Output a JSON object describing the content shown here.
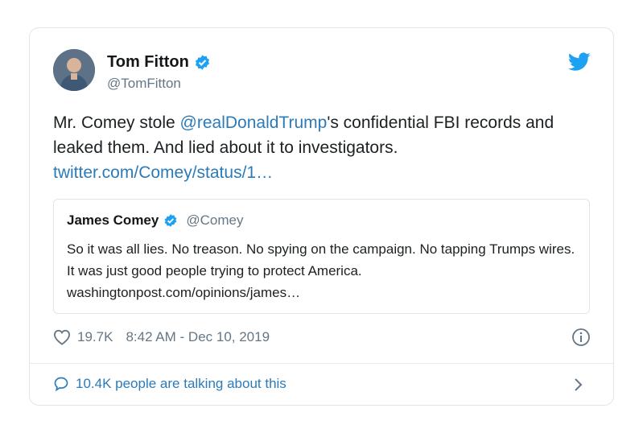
{
  "tweet": {
    "author_name": "Tom Fitton",
    "author_handle": "@TomFitton",
    "text_part1": "Mr. Comey stole ",
    "mention": "@realDonaldTrump",
    "text_part2": "'s confidential FBI records and leaked them. And lied about it to investigators.",
    "link": "twitter.com/Comey/status/1…",
    "likes": "19.7K",
    "timestamp": "8:42 AM - Dec 10, 2019",
    "talking": "10.4K people are talking about this"
  },
  "quoted": {
    "author_name": "James Comey",
    "author_handle": "@Comey",
    "text": "So it was all lies. No treason. No spying on the campaign. No tapping Trumps wires. It was just good people trying to protect America.",
    "link": "washingtonpost.com/opinions/james…"
  },
  "icons": {
    "verified": "verified-badge-icon",
    "brand": "twitter-bird-icon",
    "like": "heart-icon",
    "info": "info-icon",
    "reply": "speech-bubble-icon",
    "chevron": "chevron-right-icon"
  },
  "colors": {
    "link": "#2b7bb9",
    "secondary_text": "#657786",
    "verified": "#1da1f2",
    "border": "#dfe5ea"
  }
}
